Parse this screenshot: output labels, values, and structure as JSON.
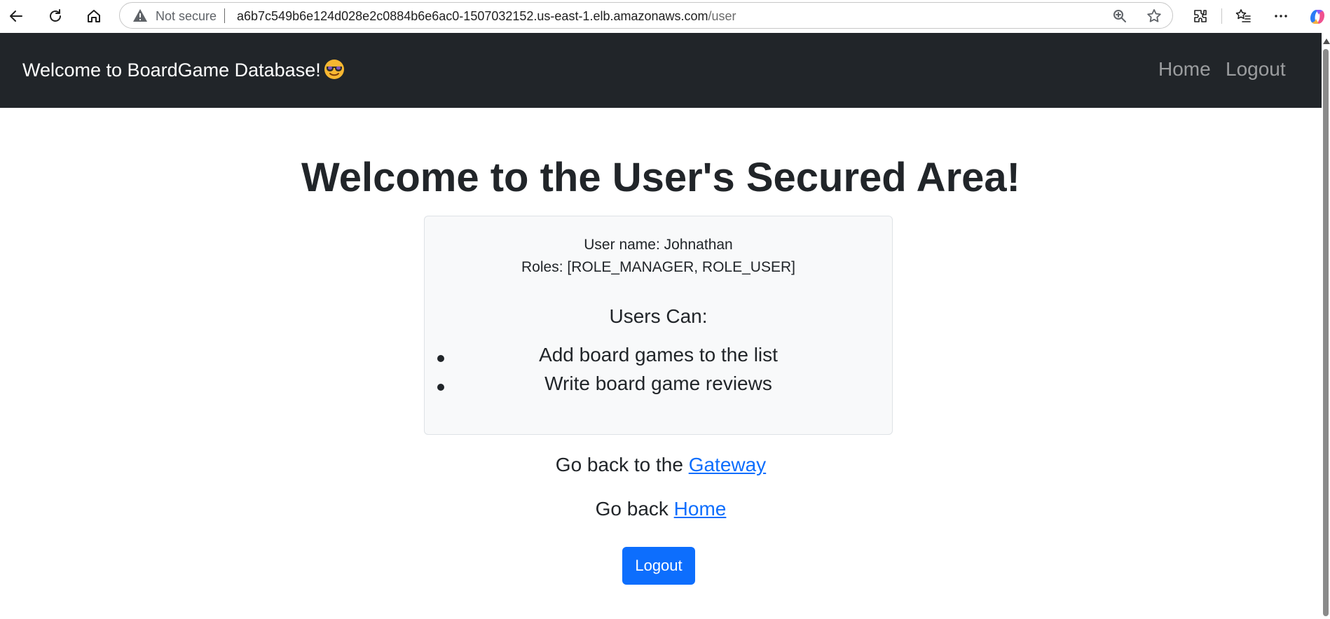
{
  "browser": {
    "security_text": "Not secure",
    "url_host": "a6b7c549b6e124d028e2c0884b6e6ac0-1507032152.us-east-1.elb.amazonaws.com",
    "url_path": "/user"
  },
  "navbar": {
    "brand": "Welcome to BoardGame Database!",
    "links": [
      {
        "label": "Home"
      },
      {
        "label": "Logout"
      }
    ]
  },
  "main": {
    "title": "Welcome to the User's Secured Area!",
    "card": {
      "username_line": "User name: Johnathan",
      "roles_line": "Roles: [ROLE_MANAGER, ROLE_USER]",
      "heading": "Users Can:",
      "items": [
        "Add board games to the list",
        "Write board game reviews"
      ]
    },
    "gateway_prefix": "Go back to the",
    "gateway_link": "Gateway",
    "home_prefix": "Go back",
    "home_link": "Home",
    "logout_button": "Logout"
  },
  "colors": {
    "navbar_bg": "#212529",
    "primary": "#0d6efd",
    "card_bg": "#f8f9fa"
  }
}
